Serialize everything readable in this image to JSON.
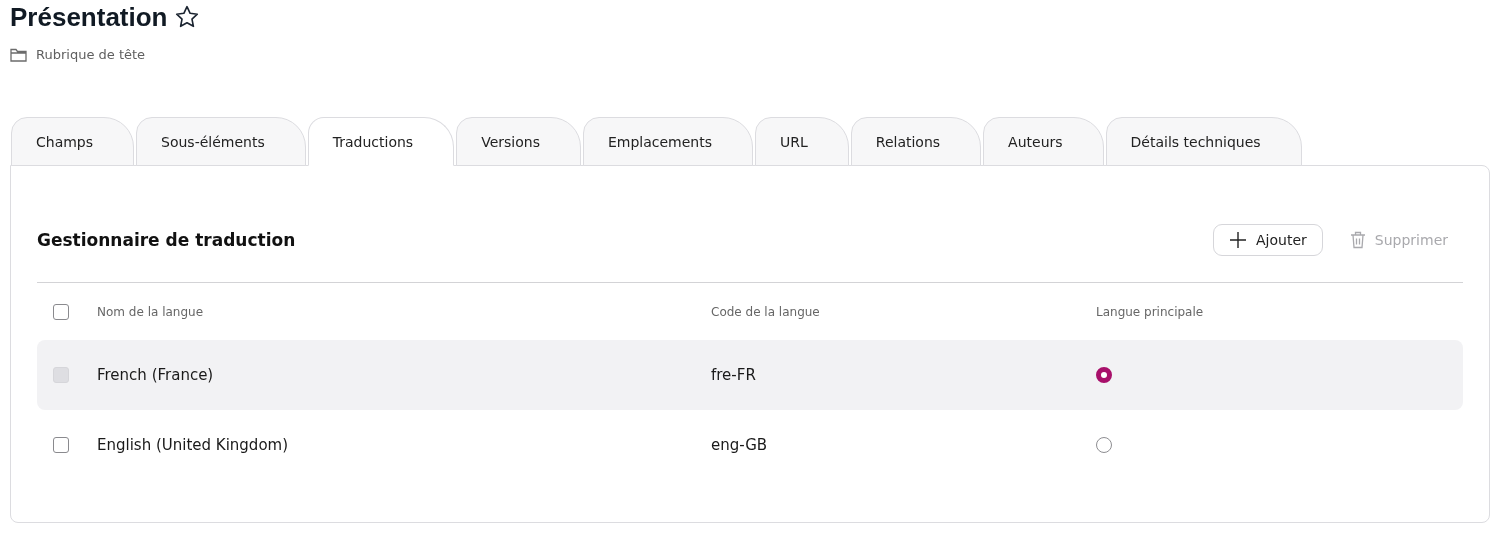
{
  "page": {
    "title": "Présentation",
    "favorite": false,
    "location": "Rubrique de tête"
  },
  "tabs": [
    {
      "label": "Champs",
      "selected": false
    },
    {
      "label": "Sous-éléments",
      "selected": false
    },
    {
      "label": "Traductions",
      "selected": true
    },
    {
      "label": "Versions",
      "selected": false
    },
    {
      "label": "Emplacements",
      "selected": false
    },
    {
      "label": "URL",
      "selected": false
    },
    {
      "label": "Relations",
      "selected": false
    },
    {
      "label": "Auteurs",
      "selected": false
    },
    {
      "label": "Détails techniques",
      "selected": false
    }
  ],
  "panel": {
    "title": "Gestionnaire de traduction",
    "buttons": [
      {
        "label": "Ajouter",
        "kind": "add",
        "disabled": false
      },
      {
        "label": "Supprimer",
        "kind": "delete",
        "disabled": true
      }
    ]
  },
  "table": {
    "select_all": {
      "checked": false
    },
    "columns": [
      "Nom de la langue",
      "Code de la langue",
      "Langue principale"
    ],
    "rows": [
      {
        "name": "French (France)",
        "code": "fre-FR",
        "checked": false,
        "disabled": true,
        "highlighted": true,
        "selected": true
      },
      {
        "name": "English (United Kingdom)",
        "code": "eng-GB",
        "checked": false,
        "disabled": false,
        "highlighted": false,
        "selected": false
      }
    ]
  }
}
